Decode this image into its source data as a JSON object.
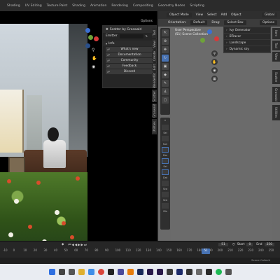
{
  "topbar": {
    "menus": [
      "Shading",
      "UV Editing",
      "Texture Paint",
      "Shading",
      "Animation",
      "Rendering",
      "Compositing",
      "Geometry Nodes",
      "Scripting"
    ]
  },
  "scatter_panel": {
    "title": "Scatter by Graswald",
    "emitter_label": "Emitter",
    "info_label": "Info",
    "options": "Options",
    "buttons": [
      "What's new",
      "Documentation",
      "Community",
      "Feedback",
      "Discord"
    ]
  },
  "left_tabs": [
    "Tool",
    "View",
    "Create",
    "Edit",
    "BlenderKit",
    "Scatter",
    "Graswald",
    "Utilities"
  ],
  "right_header": {
    "mode": "Object Mode",
    "view": "View",
    "select": "Select",
    "add": "Add",
    "object": "Object",
    "transform": "Global",
    "orientation_label": "Orientation:",
    "orientation_value": "Default",
    "drag_label": "Drag:",
    "drag_value": "Select Box",
    "options": "Options"
  },
  "viewport_info": {
    "line1": "User Perspective",
    "line2": "(51) Scene Collection"
  },
  "right_menu": [
    "Ivy Generator",
    "BTracer",
    "Landscape",
    "Dynamic sky"
  ],
  "right_tabs": [
    "Item",
    "Tool",
    "View",
    "Scatter",
    "Graswald",
    "Utilities"
  ],
  "tool_labels": [
    "Sel",
    "Sun",
    "Dar",
    "Sel",
    "Dat",
    "Sca",
    "Sca",
    "Dis"
  ],
  "timeline": {
    "frame": "51",
    "start_label": "Start",
    "start": "0",
    "end_label": "End",
    "end": "250",
    "ticks": [
      "-10",
      "0",
      "10",
      "20",
      "30",
      "40",
      "50",
      "60",
      "70",
      "80",
      "90",
      "100",
      "110",
      "120",
      "130",
      "140",
      "150",
      "160",
      "170",
      "180",
      "190",
      "200",
      "210",
      "220",
      "230",
      "240",
      "250"
    ]
  },
  "status": {
    "right": "Scene Collecti"
  },
  "colors": {
    "accent": "#4772b3",
    "panel": "#262626"
  }
}
